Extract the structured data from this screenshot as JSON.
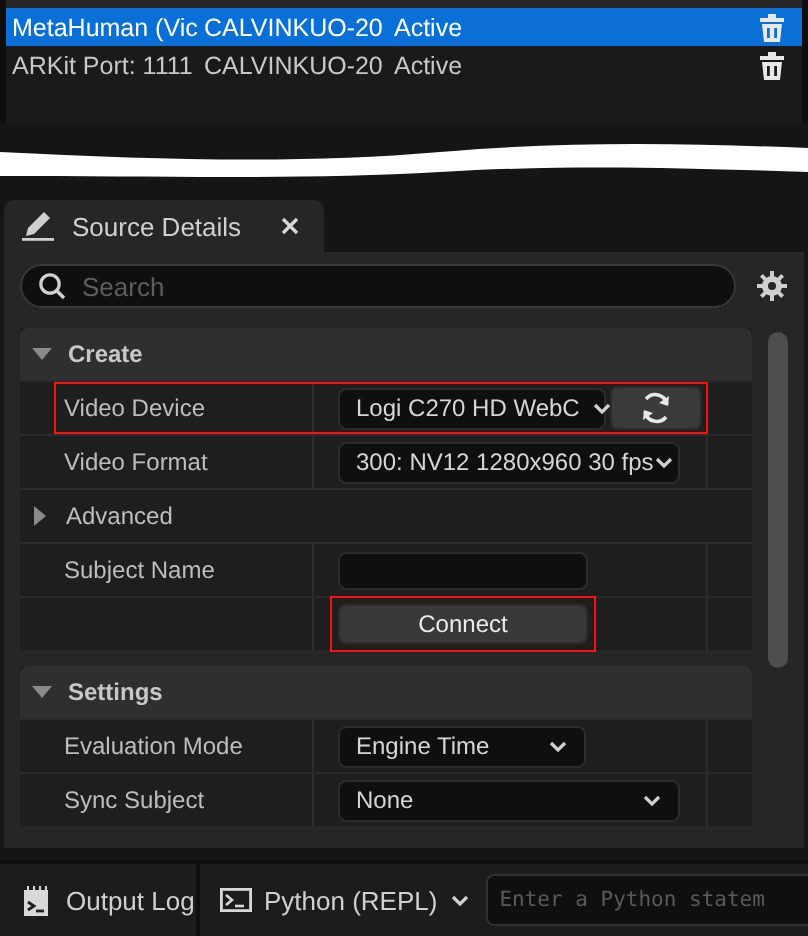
{
  "sources": {
    "rows": [
      {
        "name": "MetaHuman (Vic",
        "machine": "CALVINKUO-20",
        "status": "Active",
        "selected": true
      },
      {
        "name": "ARKit Port: 1111",
        "machine": "CALVINKUO-20",
        "status": "Active",
        "selected": false
      }
    ]
  },
  "details_tab": {
    "title": "Source Details"
  },
  "search": {
    "placeholder": "Search"
  },
  "categories": [
    {
      "title": "Create",
      "expanded": true,
      "rows": [
        {
          "kind": "dropdown",
          "label": "Video Device",
          "value": "Logi C270 HD WebC",
          "refresh": true,
          "highlighted": true
        },
        {
          "kind": "dropdown",
          "label": "Video Format",
          "value": "300: NV12 1280x960 30 fps",
          "refresh": false,
          "highlighted": false
        },
        {
          "kind": "group",
          "label": "Advanced",
          "expanded": false
        },
        {
          "kind": "text",
          "label": "Subject Name",
          "highlighted": false
        },
        {
          "kind": "button",
          "value": "Connect",
          "highlighted": true
        }
      ]
    },
    {
      "title": "Settings",
      "expanded": true,
      "rows": [
        {
          "kind": "dropdown",
          "label": "Evaluation Mode",
          "value": "Engine Time",
          "refresh": false,
          "highlighted": false
        },
        {
          "kind": "dropdown",
          "label": "Sync Subject",
          "value": "None",
          "refresh": false,
          "highlighted": false
        }
      ]
    }
  ],
  "bottom_bar": {
    "output_log": "Output Log",
    "console": "Python (REPL)",
    "command_placeholder": "Enter a Python statem"
  }
}
